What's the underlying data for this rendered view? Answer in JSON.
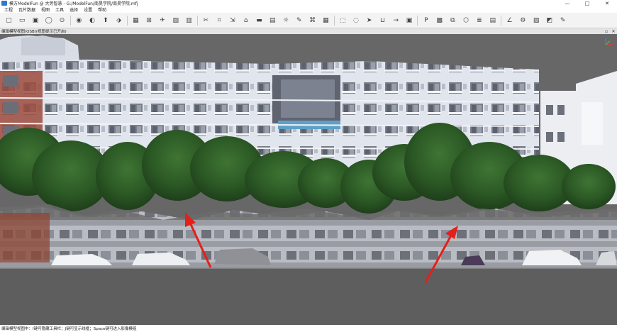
{
  "window": {
    "title": "模方ModelFun @ 大势智慧 - G:/ModelFun/南昊学院/南昊学院.mfj",
    "minimize": "—",
    "maximize": "□",
    "close": "✕"
  },
  "menu": [
    "工程",
    "瓦片数据",
    "视图",
    "工具",
    "选择",
    "设置",
    "帮助"
  ],
  "toolbar": {
    "groups": [
      [
        "new-icon",
        "open-icon",
        "save-icon",
        "undo-icon",
        "redo-icon"
      ],
      [
        "record-icon",
        "show-icon",
        "upload-icon",
        "export-icon"
      ],
      [
        "grid-icon",
        "network-icon",
        "plane-icon",
        "image-icon",
        "book-icon"
      ],
      [
        "trim-icon",
        "crop-icon",
        "scale-icon",
        "roof-icon",
        "flatten-icon",
        "wall-icon",
        "light-icon",
        "paint-icon",
        "cut-icon",
        "tile-icon"
      ],
      [
        "select-box-icon",
        "lasso-icon",
        "cursor-icon",
        "basket-icon",
        "arrow-icon",
        "fit-icon"
      ],
      [
        "ps-icon",
        "texture-icon",
        "copy-icon",
        "cube-icon",
        "layers-icon",
        "paste-icon"
      ],
      [
        "axis-icon",
        "settings-icon",
        "clipboard-icon",
        "diagonal-icon",
        "edit-icon"
      ]
    ]
  },
  "viewport": {
    "title": "编辑模型视图(OSB)(视图提示已开启)",
    "restore": "▫",
    "close": "✕"
  },
  "status": {
    "text": "编辑模型视图中：I键可隐藏工具栏；J键可显示线框；Space键可进入影像模组"
  },
  "colors": {
    "arrow": "#e3201b",
    "sky": "#6a6a6a",
    "building": "#dfe3ec",
    "tree": "#2e5a26",
    "road": "#5c5c5c"
  }
}
